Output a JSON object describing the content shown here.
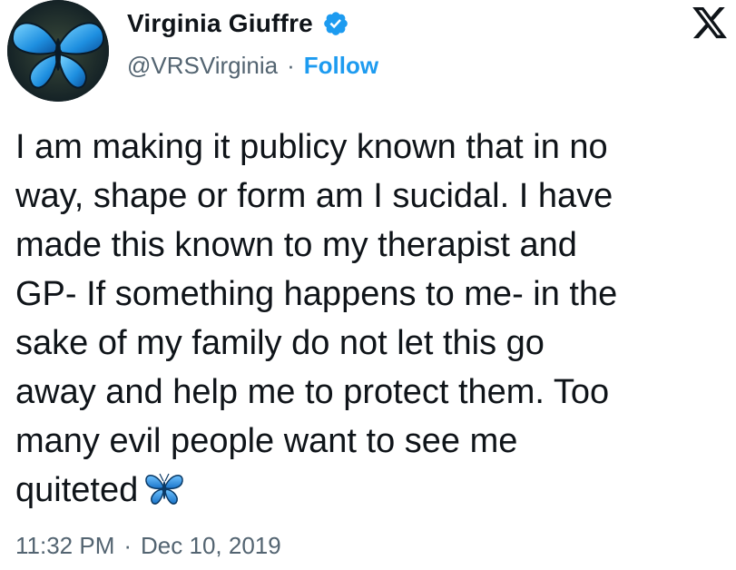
{
  "author": {
    "display_name": "Virginia Giuffre",
    "handle": "@VRSVirginia",
    "separator": "·",
    "follow_label": "Follow",
    "verified_color": "#1d9bf0",
    "avatar_icon": "blue-butterfly-icon"
  },
  "brand": {
    "logo_icon": "x-logo-icon"
  },
  "tweet": {
    "lines": [
      "I am making it publicy known that in no",
      "way, shape or form am I sucidal. I have",
      "made this known to my therapist and",
      "GP- If something happens to me- in the",
      "sake of my family do not let this go",
      "away and help me to protect them. Too",
      "many evil people want to see me",
      "quiteted"
    ],
    "emoji": "butterfly-emoji"
  },
  "meta": {
    "time": "11:32 PM",
    "separator": "·",
    "date": "Dec 10, 2019"
  },
  "colors": {
    "text": "#0f1419",
    "secondary": "#536471",
    "accent": "#1d9bf0"
  }
}
